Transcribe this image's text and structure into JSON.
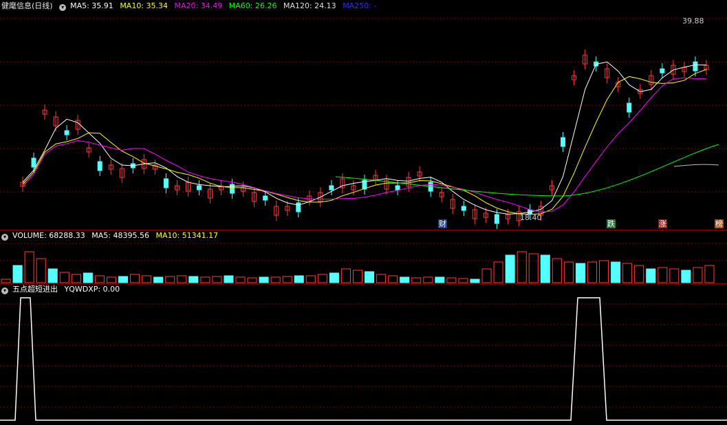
{
  "header": {
    "stock": "健麾信息(日线)",
    "ma5": "MA5: 35.91",
    "ma10": "MA10: 35.34",
    "ma20": "MA20: 34.49",
    "ma60": "MA60: 26.26",
    "ma120": "MA120: 24.13",
    "ma250": "MA250: -"
  },
  "volume_header": {
    "volume": "VOLUME: 68288.33",
    "ma5": "MA5: 48395.56",
    "ma10": "MA10: 51341.17"
  },
  "indicator_header": {
    "name": "五点超短进出",
    "value": "YQWDXP: 0.00"
  },
  "annotations": {
    "high_label": "39.88",
    "low_label": "18.40",
    "event_cai": "财",
    "event_die": "跌",
    "event_zhang": "涨",
    "event_bang": "榜"
  },
  "colors": {
    "up": "#ff3b3b",
    "down": "#54ffff",
    "ma5": "#ffffff",
    "ma10": "#ffff00",
    "ma20": "#ff00ff",
    "ma60": "#00ff00",
    "ma120": "#c0c0c0",
    "ma250": "#0000ff",
    "grid": "#8b0000"
  }
}
